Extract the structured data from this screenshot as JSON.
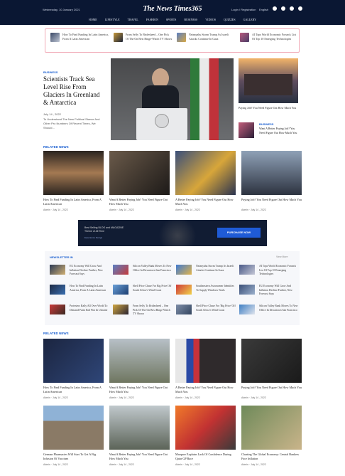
{
  "header": {
    "date": "Wednesday, 10 January 2021",
    "logo": "The News Times365",
    "account": "Login / Registration",
    "language": "English",
    "social_icons": [
      "facebook-icon",
      "twitter-icon",
      "instagram-icon",
      "youtube-icon"
    ]
  },
  "nav": [
    "HOME",
    "LIFESTYLE",
    "TRAVEL",
    "FASHION",
    "SPORTS",
    "BUSINESS",
    "VIDEOS",
    "QUIZZES",
    "GALLERY"
  ],
  "ticker": [
    "How To Find Funding In Latin America, From A Latin American",
    "From Selfy To Bridesheed – One Pick Of The On Best Binge-Watch TV Shows",
    "Netanyahu Storm Trump As Israeli Attacks Continue In Gaza",
    "AI Tops World Economic Forum's List Of Top 10 Emerging Technologies"
  ],
  "hero": {
    "category": "BUSINESS",
    "title": "Scientists Track Sea Level Rise From Glaciers In Greenland & Antarctica",
    "date": "July 14 , 2022",
    "desc": "To Understand The New Political Stance And Other Pro Numbers Of Recent Times, We Should…"
  },
  "side": {
    "caption": "Paying Job? You Need Figure Out How Much You",
    "item_category": "BUSINESS",
    "item_title": "Want A Better Paying Job? You Need Figure Out How Much You"
  },
  "sections": {
    "related1": "RELATED NEWS",
    "newsletter": "NEWSLETTER IN",
    "newsletter_view": "View More",
    "related2": "RELATED NEWS"
  },
  "related1": [
    {
      "title": "How To Find Funding In Latin America, From A Latin American",
      "meta": "Admin  ·  July 14 , 2022"
    },
    {
      "title": "Want A Better Paying Job? You Need Figure Out How Much You",
      "meta": "Admin  ·  July 14 , 2022"
    },
    {
      "title": "A Better Paying Job? You Need Figure Out How Much You",
      "meta": "Admin  ·  July 14 , 2022"
    },
    {
      "title": "Paying Job? You Need Figure Out How Much You",
      "meta": "Admin  ·  July 14 , 2022"
    }
  ],
  "banner": {
    "line1": "Best Selling BLOG and MAGAZINE",
    "line2": "Theme of All Time",
    "sub": "Experience Design",
    "button": "PURCHASE NOW"
  },
  "newsletter": [
    "EU Economy Will Grow And Inflation Decline Further, New Forecast Says",
    "Silicon Valley Bank Moves To New Office In Downtown San Francisco",
    "Netanyahu Storm Trump As Israeli Attacks Continue In Gaza",
    "AI Tops World Economic Forum's List Of Top 10 Emerging Technologies",
    "How To Find Funding In Latin America, From A Latin American",
    "Shell Price Chase For Big Price Off South Africa's Wind Coast",
    "Southeastern Astronomer Identifies To Supply Windows Trials",
    "EU Economy Will Grow And Inflation Decline Further, New Forecast Says",
    "Protesters Rally All Over World To Demand Putin End War In Ukraine",
    "From Selfy To Bridesheed – One Pick Of The On Best Binge-Watch TV Shows",
    "Shell Price Chase For 'Big Price' Off South Africa's Wind Coast",
    "Silicon Valley Bank Moves To New Office In Downtown San Francisco"
  ],
  "related2": [
    {
      "title": "How To Find Funding In Latin America, From A Latin American",
      "meta": "Admin  ·  July 14 , 2022"
    },
    {
      "title": "Want A Better Paying Job? You Need Figure Out How Much You",
      "meta": "Admin  ·  July 14 , 2022"
    },
    {
      "title": "A Better Paying Job? You Need Figure Out How Much You",
      "meta": "Admin  ·  July 14 , 2022"
    },
    {
      "title": "Paying Job? You Need Figure Out How Much You",
      "meta": "Admin  ·  July 14 , 2022"
    },
    {
      "title": "German Pharmacies Will Start To Get A Big Infusion Of Vaccines",
      "meta": "Admin  ·  July 14 , 2022"
    },
    {
      "title": "Want A Better Paying Job? You Need Figure Out How Much You",
      "meta": "Admin  ·  July 14 , 2022"
    },
    {
      "title": "Marquez Explains Lack Of Confidence During Qatar GP Race",
      "meta": "Admin  ·  July 14 , 2022"
    },
    {
      "title": "Charting The Global Economy: Central Bankers Face Inflation",
      "meta": "Admin  ·  July 14 , 2022"
    }
  ]
}
